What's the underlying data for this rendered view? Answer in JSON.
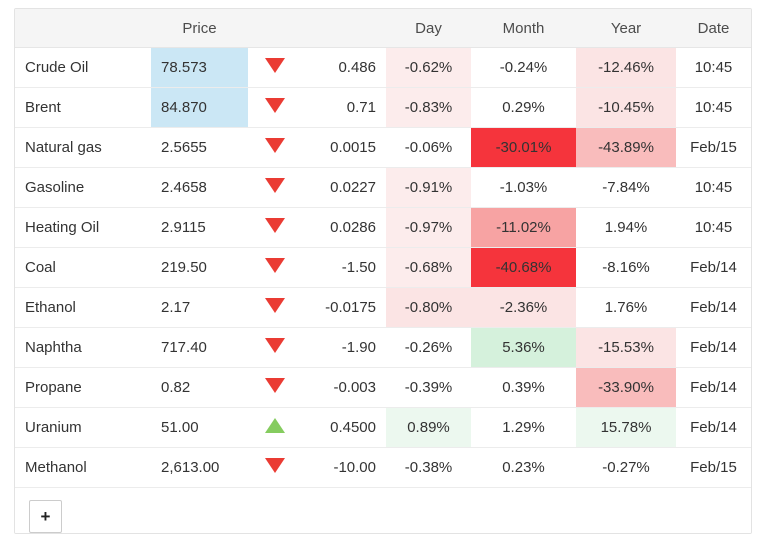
{
  "table": {
    "headers": {
      "name": "",
      "price": "Price",
      "arrow": "",
      "change": "",
      "day": "Day",
      "month": "Month",
      "year": "Year",
      "date": "Date"
    },
    "rows": [
      {
        "name": "Crude Oil",
        "price": "78.573",
        "price_bg": "bg-blue",
        "direction": "down",
        "change": "0.486",
        "change_tone": "chg-neg",
        "day": "-0.62%",
        "day_bg": "bg-pink-xs",
        "month": "-0.24%",
        "month_bg": "bg-none",
        "year": "-12.46%",
        "year_bg": "bg-pink-s",
        "date": "10:45"
      },
      {
        "name": "Brent",
        "price": "84.870",
        "price_bg": "bg-blue",
        "direction": "down",
        "change": "0.71",
        "change_tone": "chg-neg",
        "day": "-0.83%",
        "day_bg": "bg-pink-xs",
        "month": "0.29%",
        "month_bg": "bg-none",
        "year": "-10.45%",
        "year_bg": "bg-pink-s",
        "date": "10:45"
      },
      {
        "name": "Natural gas",
        "price": "2.5655",
        "price_bg": "bg-none",
        "direction": "down",
        "change": "0.0015",
        "change_tone": "chg-pos",
        "day": "-0.06%",
        "day_bg": "bg-none",
        "month": "-30.01%",
        "month_bg": "bg-red",
        "year": "-43.89%",
        "year_bg": "bg-pink-m",
        "date": "Feb/15"
      },
      {
        "name": "Gasoline",
        "price": "2.4658",
        "price_bg": "bg-none",
        "direction": "down",
        "change": "0.0227",
        "change_tone": "chg-pos",
        "day": "-0.91%",
        "day_bg": "bg-pink-xs",
        "month": "-1.03%",
        "month_bg": "bg-none",
        "year": "-7.84%",
        "year_bg": "bg-none",
        "date": "10:45"
      },
      {
        "name": "Heating Oil",
        "price": "2.9115",
        "price_bg": "bg-none",
        "direction": "down",
        "change": "0.0286",
        "change_tone": "chg-pos",
        "day": "-0.97%",
        "day_bg": "bg-pink-xs",
        "month": "-11.02%",
        "month_bg": "bg-pink-l",
        "year": "1.94%",
        "year_bg": "bg-none",
        "date": "10:45"
      },
      {
        "name": "Coal",
        "price": "219.50",
        "price_bg": "bg-none",
        "direction": "down",
        "change": "-1.50",
        "change_tone": "chg-pos",
        "day": "-0.68%",
        "day_bg": "bg-pink-xs",
        "month": "-40.68%",
        "month_bg": "bg-red",
        "year": "-8.16%",
        "year_bg": "bg-none",
        "date": "Feb/14"
      },
      {
        "name": "Ethanol",
        "price": "2.17",
        "price_bg": "bg-none",
        "direction": "down",
        "change": "-0.0175",
        "change_tone": "chg-pos",
        "day": "-0.80%",
        "day_bg": "bg-pink-s",
        "month": "-2.36%",
        "month_bg": "bg-pink-s",
        "year": "1.76%",
        "year_bg": "bg-none",
        "date": "Feb/14"
      },
      {
        "name": "Naphtha",
        "price": "717.40",
        "price_bg": "bg-none",
        "direction": "down",
        "change": "-1.90",
        "change_tone": "chg-pos",
        "day": "-0.26%",
        "day_bg": "bg-none",
        "month": "5.36%",
        "month_bg": "bg-green-s",
        "year": "-15.53%",
        "year_bg": "bg-pink-s",
        "date": "Feb/14"
      },
      {
        "name": "Propane",
        "price": "0.82",
        "price_bg": "bg-none",
        "direction": "down",
        "change": "-0.003",
        "change_tone": "chg-pos",
        "day": "-0.39%",
        "day_bg": "bg-none",
        "month": "0.39%",
        "month_bg": "bg-none",
        "year": "-33.90%",
        "year_bg": "bg-pink-m",
        "date": "Feb/14"
      },
      {
        "name": "Uranium",
        "price": "51.00",
        "price_bg": "bg-none",
        "direction": "up",
        "change": "0.4500",
        "change_tone": "chg-pos",
        "day": "0.89%",
        "day_bg": "bg-green-xs",
        "month": "1.29%",
        "month_bg": "bg-none",
        "year": "15.78%",
        "year_bg": "bg-green-xs",
        "date": "Feb/14"
      },
      {
        "name": "Methanol",
        "price": "2,613.00",
        "price_bg": "bg-none",
        "direction": "down",
        "change": "-10.00",
        "change_tone": "chg-pos",
        "day": "-0.38%",
        "day_bg": "bg-none",
        "month": "0.23%",
        "month_bg": "bg-none",
        "year": "-0.27%",
        "year_bg": "bg-none",
        "date": "Feb/15"
      }
    ]
  },
  "footer": {
    "add_label": "+"
  },
  "colors": {
    "down_arrow": "#ea3b33",
    "up_arrow": "#85cc5f",
    "price_highlight": "#cbe7f5",
    "heat_red": "#f5343c",
    "heat_green": "#d5f1dc"
  }
}
